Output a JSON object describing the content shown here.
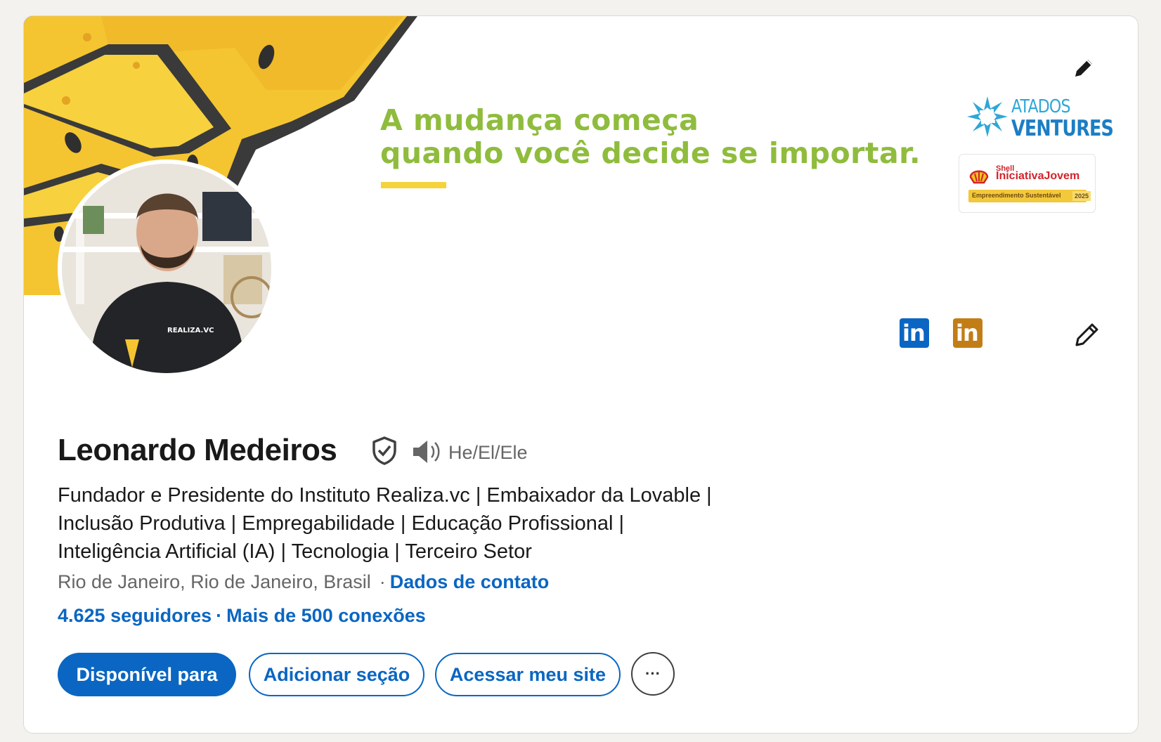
{
  "banner": {
    "tagline_line1": "A mudança começa",
    "tagline_line2": "quando você decide se importar.",
    "logo_atados_line1": "ATADOS",
    "logo_atados_line2": "VENTURES",
    "logo_shell_brand": "Shell",
    "logo_shell_program": "IniciativaJovem",
    "logo_shell_category": "Empreendimento Sustentável",
    "logo_shell_year": "2025"
  },
  "profile": {
    "name": "Leonardo Medeiros",
    "pronouns": "He/El/Ele",
    "headline": "Fundador e Presidente do Instituto Realiza.vc | Embaixador da Lovable | Inclusão Produtiva | Empregabilidade | Educação Profissional | Inteligência Artificial (IA) | Tecnologia | Terceiro Setor",
    "location": "Rio de Janeiro, Rio de Janeiro, Brasil",
    "contact_link": "Dados de contato",
    "followers": "4.625 seguidores",
    "separator": "·",
    "connections": "Mais de 500 conexões"
  },
  "actions": {
    "open_to": "Disponível para",
    "add_section": "Adicionar seção",
    "visit_site": "Acessar meu site",
    "more": "···"
  },
  "icons": {
    "linkedin_blue_label": "in",
    "linkedin_gold_label": "in",
    "linkedin_blue_color": "#0a66c2",
    "linkedin_gold_color": "#c37d16"
  },
  "colors": {
    "accent": "#0a66c2",
    "tagline": "#8fbc3d",
    "banner_yellow": "#f5d33a"
  }
}
